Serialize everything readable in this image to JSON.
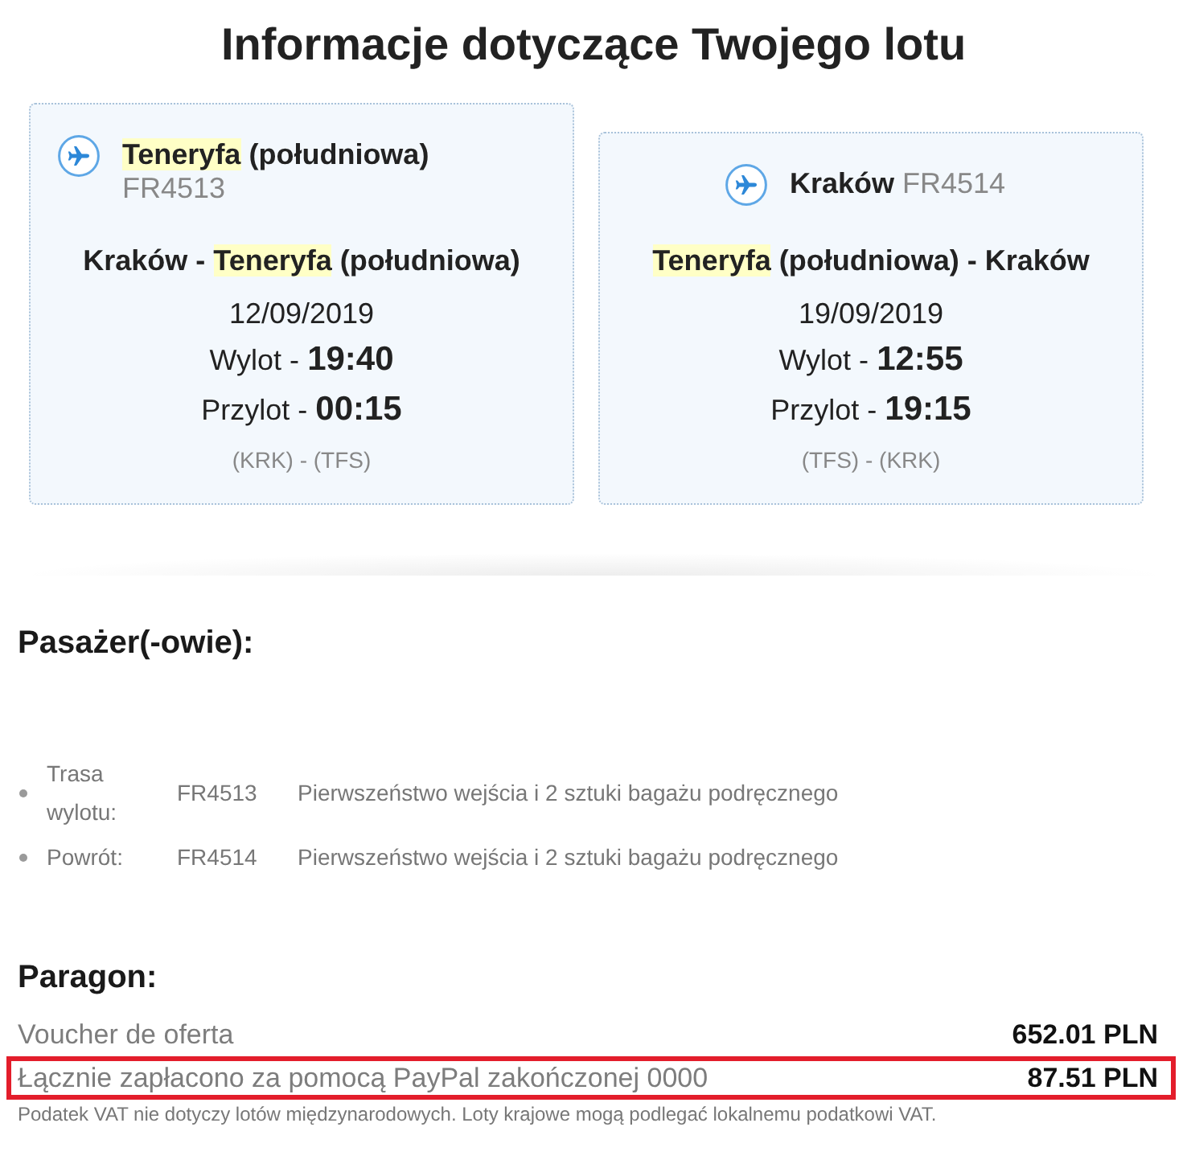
{
  "title": "Informacje dotyczące Twojego lotu",
  "flights": [
    {
      "name": [
        {
          "text": "Teneryfa",
          "highlighted": true
        },
        {
          "text": "(południowa)",
          "highlighted": false
        }
      ],
      "flight_number": "FR4513",
      "route": [
        {
          "text": "Kraków -",
          "highlighted": false
        },
        {
          "text": "Teneryfa",
          "highlighted": true
        },
        {
          "text": "(południowa)",
          "highlighted": false
        }
      ],
      "date": "12/09/2019",
      "departure": "Wylot - **19:40**",
      "arrival": "Przylot - **00:15**",
      "airports": "(KRK) - (TFS)"
    },
    {
      "name": [
        {
          "text": "Kraków",
          "highlighted": false
        }
      ],
      "flight_number": "FR4514",
      "route": [
        {
          "text": "Teneryfa",
          "highlighted": true
        },
        {
          "text": "(południowa) - Kraków",
          "highlighted": false
        }
      ],
      "date": "19/09/2019",
      "departure": "Wylot - **12:55**",
      "arrival": "Przylot - **19:15**",
      "airports": "(TFS) - (KRK)"
    }
  ],
  "passengers": {
    "heading": "Pasażer(-owie):",
    "extras": [
      {
        "segment": "Trasa wylotu:",
        "flight": "FR4513",
        "service": "Pierwszeństwo wejścia i 2 sztuki bagażu podręcznego"
      },
      {
        "segment": "Powrót:",
        "flight": "FR4514",
        "service": "Pierwszeństwo wejścia i 2 sztuki bagażu podręcznego"
      }
    ]
  },
  "receipt": {
    "heading": "Paragon:",
    "rows": [
      {
        "label": "Voucher de oferta",
        "amount": "652.01 PLN",
        "highlighted": false
      },
      {
        "label": "Łącznie zapłacono za pomocą PayPal zakończonej 0000",
        "amount": "87.51 PLN",
        "highlighted": true
      }
    ],
    "note": "Podatek VAT nie dotyczy lotów międzynarodowych. Loty krajowe mogą podlegać lokalnemu podatkowi VAT."
  }
}
